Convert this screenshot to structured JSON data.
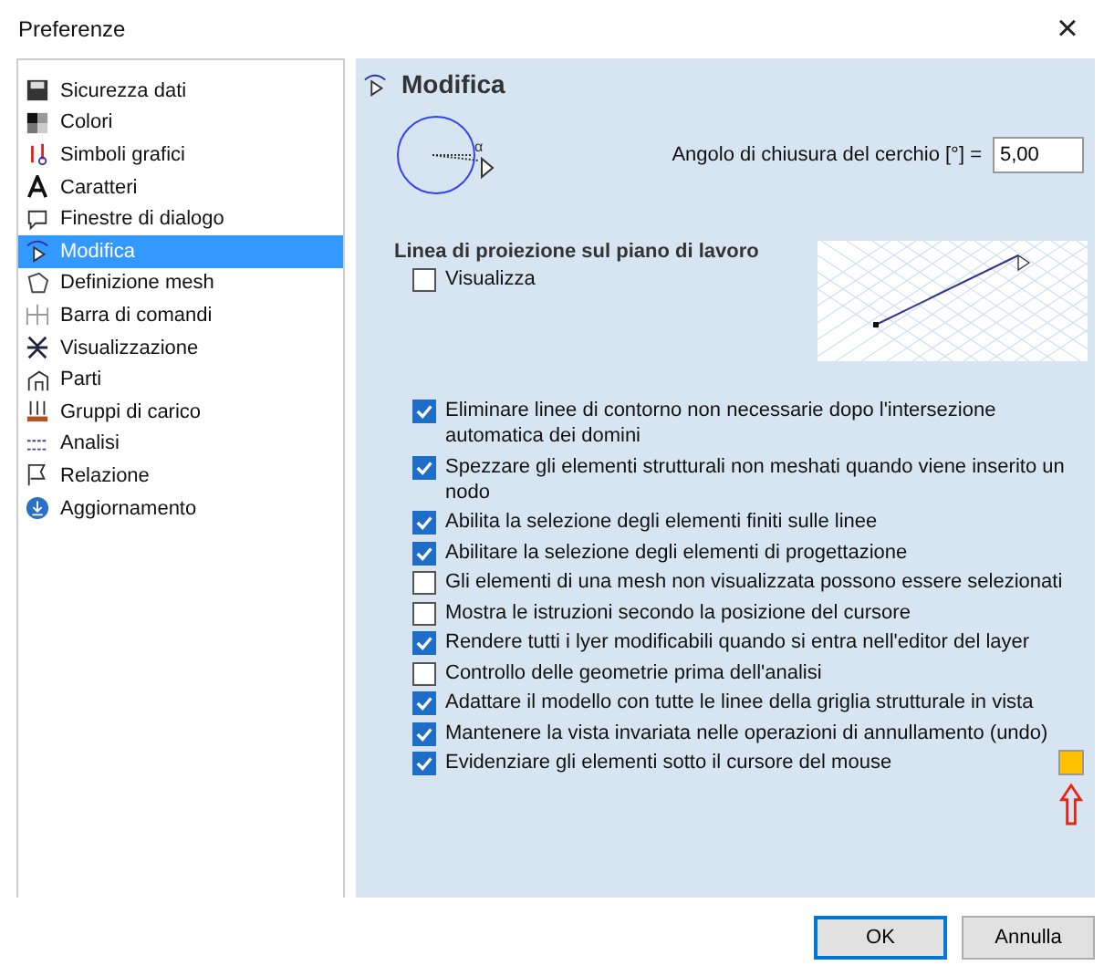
{
  "window": {
    "title": "Preferenze",
    "close": "×"
  },
  "sidebar": {
    "items": [
      {
        "label": "Sicurezza dati",
        "selected": false
      },
      {
        "label": "Colori",
        "selected": false
      },
      {
        "label": "Simboli grafici",
        "selected": false
      },
      {
        "label": "Caratteri",
        "selected": false
      },
      {
        "label": "Finestre di dialogo",
        "selected": false
      },
      {
        "label": "Modifica",
        "selected": true
      },
      {
        "label": "Definizione mesh",
        "selected": false
      },
      {
        "label": "Barra di comandi",
        "selected": false
      },
      {
        "label": "Visualizzazione",
        "selected": false
      },
      {
        "label": "Parti",
        "selected": false
      },
      {
        "label": "Gruppi di carico",
        "selected": false
      },
      {
        "label": "Analisi",
        "selected": false
      },
      {
        "label": "Relazione",
        "selected": false
      },
      {
        "label": "Aggiornamento",
        "selected": false
      }
    ]
  },
  "panel": {
    "title": "Modifica",
    "angle": {
      "label": "Angolo di chiusura del cerchio [°] =",
      "value": "5,00",
      "symbol": "α"
    },
    "projection": {
      "heading": "Linea di proiezione sul piano di lavoro",
      "option": {
        "label": "Visualizza",
        "checked": false
      }
    },
    "options": [
      {
        "label": "Eliminare linee di contorno non necessarie dopo l'intersezione automatica dei domini",
        "checked": true
      },
      {
        "label": "Spezzare gli elementi strutturali non meshati quando viene inserito un nodo",
        "checked": true
      },
      {
        "label": "Abilita la selezione degli elementi finiti sulle linee",
        "checked": true
      },
      {
        "label": "Abilitare la selezione degli elementi di progettazione",
        "checked": true
      },
      {
        "label": "Gli elementi di una mesh non visualizzata possono essere selezionati",
        "checked": false
      },
      {
        "label": "Mostra le istruzioni secondo la posizione del cursore",
        "checked": false
      },
      {
        "label": "Rendere tutti i lyer modificabili quando si entra nell'editor del layer",
        "checked": true
      },
      {
        "label": "Controllo delle geometrie prima dell'analisi",
        "checked": false
      },
      {
        "label": "Adattare il modello con tutte le linee della griglia strutturale in vista",
        "checked": true
      },
      {
        "label": "Mantenere la vista invariata nelle operazioni di annullamento (undo)",
        "checked": true
      },
      {
        "label": "Evidenziare gli elementi sotto il cursore del mouse",
        "checked": true,
        "color": "#ffc000"
      }
    ]
  },
  "buttons": [
    "OK",
    "Annulla"
  ]
}
